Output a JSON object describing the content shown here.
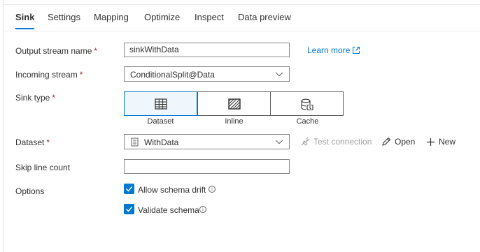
{
  "tabs": [
    {
      "label": "Sink",
      "active": true
    },
    {
      "label": "Settings"
    },
    {
      "label": "Mapping"
    },
    {
      "label": "Optimize"
    },
    {
      "label": "Inspect"
    },
    {
      "label": "Data preview"
    }
  ],
  "form": {
    "output_stream": {
      "label": "Output stream name",
      "required_mark": "*",
      "value": "sinkWithData"
    },
    "learn_more": "Learn more",
    "incoming_stream": {
      "label": "Incoming stream",
      "required_mark": "*",
      "value": "ConditionalSplit@Data"
    },
    "sink_type": {
      "label": "Sink type",
      "required_mark": "*",
      "options": [
        {
          "label": "Dataset",
          "icon": "table-icon",
          "selected": true
        },
        {
          "label": "Inline",
          "icon": "hatched-box-icon"
        },
        {
          "label": "Cache",
          "icon": "database-cache-icon"
        }
      ]
    },
    "dataset": {
      "label": "Dataset",
      "required_mark": "*",
      "value": "WithData",
      "test_connection": "Test connection",
      "open": "Open",
      "new": "New"
    },
    "skip_line_count": {
      "label": "Skip line count",
      "value": ""
    },
    "options": {
      "label": "Options",
      "allow_schema_drift": {
        "label": "Allow schema drift",
        "checked": true
      },
      "validate_schema": {
        "label": "Validate schema",
        "checked": true
      }
    }
  },
  "colors": {
    "accent": "#0078d4",
    "required": "#a4262c",
    "text": "#323130",
    "disabled": "#a19f9d"
  }
}
